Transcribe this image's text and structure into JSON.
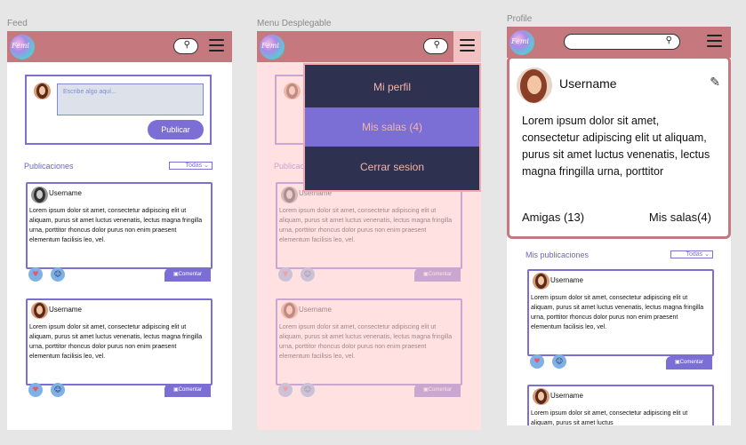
{
  "frames": {
    "feed": "Feed",
    "menu": "Menu Desplegable",
    "profile": "Profile"
  },
  "logo_text": "Femi",
  "composer": {
    "placeholder": "Escribe algo aquí...",
    "publish": "Publicar"
  },
  "feed": {
    "section_title": "Publicaciones",
    "filter": "Todas",
    "posts": [
      {
        "username": "Username",
        "text": "Lorem ipsum dolor sit amet, consectetur adipiscing elit ut aliquam, purus sit amet luctus venenatis, lectus magna fringilla urna, porttitor rhoncus dolor purus non enim praesent elementum facilisis leo, vel.",
        "comment": "Comentar"
      },
      {
        "username": "Username",
        "text": "Lorem ipsum dolor sit amet, consectetur adipiscing elit ut aliquam, purus sit amet luctus venenatis, lectus magna fringilla urna, porttitor rhoncus dolor purus non enim praesent elementum facilisis leo, vel.",
        "comment": "Comentar"
      }
    ]
  },
  "menu": {
    "items": [
      "Mi perfil",
      "Mis salas (4)",
      "Cerrar sesion"
    ]
  },
  "profile": {
    "username": "Username",
    "bio": "Lorem ipsum dolor sit amet, consectetur adipiscing elit ut aliquam, purus sit amet luctus venenatis, lectus magna fringilla urna, porttitor",
    "friends": "Amigas (13)",
    "rooms": "Mis salas(4)",
    "section_title": "Mis publicaciones",
    "filter": "Todas",
    "posts": [
      {
        "username": "Username",
        "text": "Lorem ipsum dolor sit amet, consectetur adipiscing elit ut aliquam, purus sit amet luctus venenatis, lectus magna fringilla urna, porttitor rhoncus dolor purus non enim praesent elementum facilisis leo, vel.",
        "comment": "Comentar"
      },
      {
        "username": "Username",
        "text": "Lorem ipsum dolor sit amet, consectetur adipiscing elit ut aliquam, purus sit amet luctus"
      }
    ]
  },
  "icons": {
    "search": "search-icon",
    "menu": "hamburger-icon",
    "heart": "heart-icon",
    "face": "face-icon",
    "comment": "comment-icon",
    "edit": "edit-icon"
  },
  "colors": {
    "topbar": "#c5797f",
    "accent": "#7b6fd6",
    "menu_bg": "#2e3150",
    "menu_text": "#f3b5a8"
  }
}
